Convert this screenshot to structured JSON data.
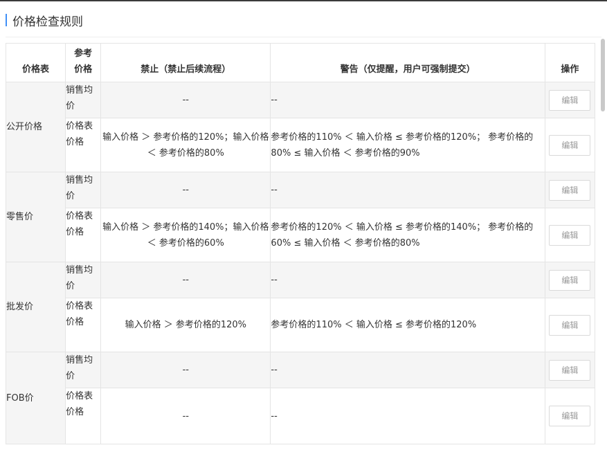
{
  "section": {
    "title": "价格检查规则"
  },
  "table": {
    "headers": {
      "price_list": "价格表",
      "ref_price": "参考价格",
      "forbid": "禁止（禁止后续流程）",
      "warn": "警告（仅提醒，用户可强制提交）",
      "action": "操作"
    },
    "groups": [
      {
        "name": "公开价格",
        "rows": [
          {
            "ref": "销售均价",
            "forbid": "--",
            "warn": "--",
            "action": "编辑"
          },
          {
            "ref": "价格表价格",
            "forbid": "输入价格 ＞ 参考价格的120%；输入价格 ＜ 参考价格的80%",
            "warn": "参考价格的110% ＜ 输入价格 ≤ 参考价格的120%； 参考价格的80% ≤ 输入价格 ＜ 参考价格的90%",
            "action": "编辑"
          }
        ]
      },
      {
        "name": "零售价",
        "rows": [
          {
            "ref": "销售均价",
            "forbid": "--",
            "warn": "--",
            "action": "编辑"
          },
          {
            "ref": "价格表价格",
            "forbid": "输入价格 ＞ 参考价格的140%；输入价格 ＜ 参考价格的60%",
            "warn": "参考价格的120% ＜ 输入价格 ≤ 参考价格的140%； 参考价格的60% ≤ 输入价格 ＜ 参考价格的80%",
            "action": "编辑"
          }
        ]
      },
      {
        "name": "批发价",
        "rows": [
          {
            "ref": "销售均价",
            "forbid": "--",
            "warn": "--",
            "action": "编辑"
          },
          {
            "ref": "价格表价格",
            "forbid": "输入价格 ＞ 参考价格的120%",
            "warn": "参考价格的110% ＜ 输入价格 ≤ 参考价格的120%",
            "action": "编辑"
          }
        ]
      },
      {
        "name": "FOB价",
        "rows": [
          {
            "ref": "销售均价",
            "forbid": "--",
            "warn": "--",
            "action": "编辑"
          },
          {
            "ref": "价格表价格",
            "forbid": "--",
            "warn": "--",
            "action": "编辑"
          }
        ]
      }
    ]
  },
  "colors": {
    "accent": "#3f8ff7",
    "shaded_row": "#f5f5f5",
    "border": "#e4e4e4",
    "top_bar": "#3a3a3a"
  }
}
